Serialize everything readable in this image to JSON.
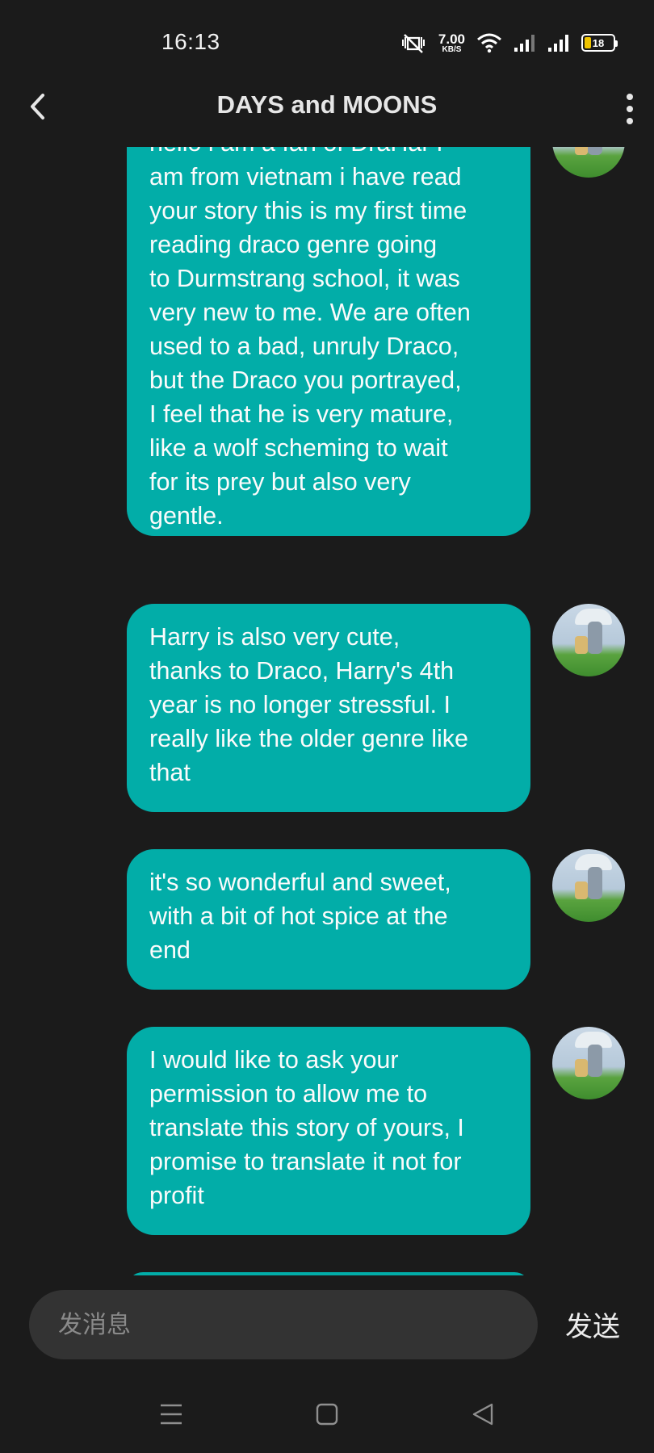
{
  "status_bar": {
    "time": "16:13",
    "network_speed_value": "7.00",
    "network_speed_unit": "KB/S",
    "battery_level": "18",
    "icons": [
      "mute-vibrate-icon",
      "wifi-icon",
      "signal-icon",
      "signal-icon",
      "battery-icon"
    ]
  },
  "header": {
    "title": "DAYS and MOONS",
    "back_icon": "chevron-left-icon",
    "more_icon": "more-vertical-icon"
  },
  "messages": [
    {
      "text": "hello i am a fan of DraHar i\nam from vietnam i have read\nyour story this is my first time\nreading draco genre going\nto Durmstrang school, it was\nvery new to me. We are often\nused to a bad, unruly Draco,\nbut the Draco you portrayed,\nI feel that he is very mature,\nlike a wolf scheming to wait\nfor its prey but also very\ngentle."
    },
    {
      "text": "Harry is also very cute,\nthanks to Draco, Harry's 4th\nyear is no longer stressful. I\nreally like the older genre like\nthat"
    },
    {
      "text": "it's so wonderful and sweet,\nwith a bit of hot spice at the\nend"
    },
    {
      "text": "I would like to ask your\npermission to allow me to\ntranslate this story of yours, I\npromise to translate it not for\nprofit"
    }
  ],
  "input": {
    "placeholder": "发消息",
    "value": "",
    "send_label": "发送"
  },
  "nav_bar": {
    "icons": [
      "menu-icon",
      "home-square-icon",
      "back-triangle-icon"
    ]
  },
  "colors": {
    "background": "#1b1b1b",
    "bubble": "#02ada8",
    "input_bg": "#333333"
  }
}
